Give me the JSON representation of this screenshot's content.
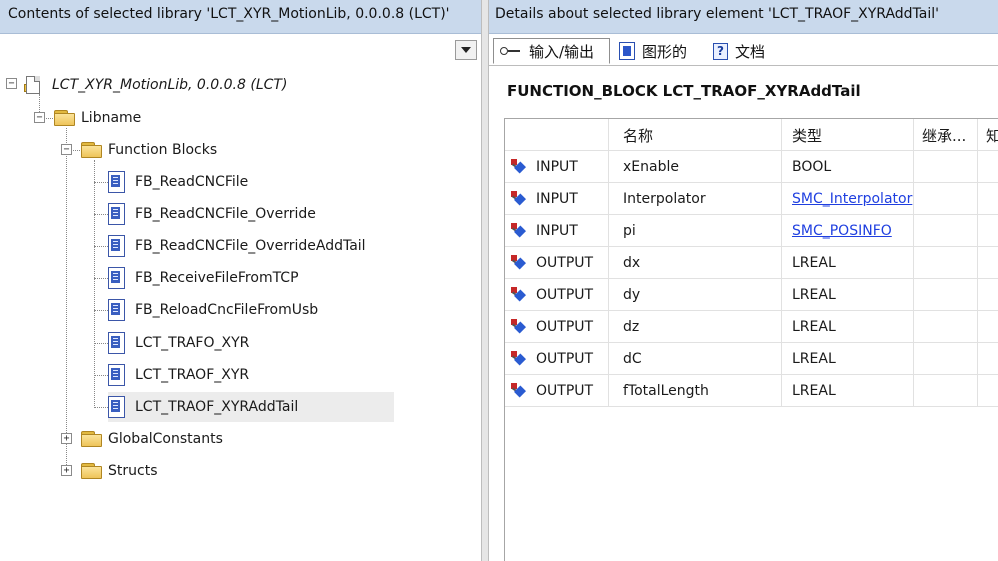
{
  "left": {
    "header": "Contents of selected library 'LCT_XYR_MotionLib, 0.0.0.8 (LCT)'",
    "root": "LCT_XYR_MotionLib, 0.0.0.8 (LCT)",
    "libname": "Libname",
    "function_blocks": "Function Blocks",
    "items": [
      "FB_ReadCNCFile",
      "FB_ReadCNCFile_Override",
      "FB_ReadCNCFile_OverrideAddTail",
      "FB_ReceiveFileFromTCP",
      "FB_ReloadCncFileFromUsb",
      "LCT_TRAFO_XYR",
      "LCT_TRAOF_XYR",
      "LCT_TRAOF_XYRAddTail"
    ],
    "global_constants": "GlobalConstants",
    "structs": "Structs",
    "selected_item": "LCT_TRAOF_XYRAddTail"
  },
  "right": {
    "header": "Details about selected library element 'LCT_TRAOF_XYRAddTail'",
    "tabs": [
      {
        "label": "输入/输出",
        "icon": "input-output-icon"
      },
      {
        "label": "图形的",
        "icon": "graphic-icon"
      },
      {
        "label": "文档",
        "icon": "documentation-icon"
      }
    ],
    "fb_title": "FUNCTION_BLOCK  LCT_TRAOF_XYRAddTail",
    "columns": {
      "name": "名称",
      "type": "类型",
      "inherit": "继承...",
      "extra": "知"
    },
    "rows": [
      {
        "kind": "INPUT",
        "name": "xEnable",
        "type": "BOOL",
        "type_is_link": false
      },
      {
        "kind": "INPUT",
        "name": "Interpolator",
        "type": "SMC_Interpolator",
        "type_is_link": true
      },
      {
        "kind": "INPUT",
        "name": "pi",
        "type": "SMC_POSINFO",
        "type_is_link": true
      },
      {
        "kind": "OUTPUT",
        "name": "dx",
        "type": "LREAL",
        "type_is_link": false
      },
      {
        "kind": "OUTPUT",
        "name": "dy",
        "type": "LREAL",
        "type_is_link": false
      },
      {
        "kind": "OUTPUT",
        "name": "dz",
        "type": "LREAL",
        "type_is_link": false
      },
      {
        "kind": "OUTPUT",
        "name": "dC",
        "type": "LREAL",
        "type_is_link": false
      },
      {
        "kind": "OUTPUT",
        "name": "fTotalLength",
        "type": "LREAL",
        "type_is_link": false
      }
    ]
  },
  "colors": {
    "header_bg": "#c9d9ec",
    "link": "#1f3fe0",
    "selected_row": "#ececec"
  }
}
